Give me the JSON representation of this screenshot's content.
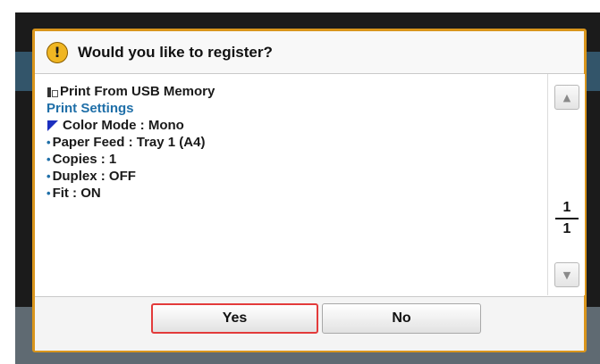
{
  "dialog": {
    "title": "Would you like to register?",
    "warning_glyph": "!",
    "icon": "warning-icon"
  },
  "content": {
    "heading": "Print From USB Memory",
    "section": "Print Settings",
    "selected_item": "Color Mode : Mono",
    "items": [
      "Paper Feed : Tray 1 (A4)",
      "Copies : 1",
      "Duplex : OFF",
      "Fit : ON"
    ]
  },
  "pager": {
    "current": "1",
    "total": "1"
  },
  "buttons": {
    "yes": "Yes",
    "no": "No"
  },
  "colors": {
    "border": "#d9951c",
    "accent": "#1f6fa8",
    "selection": "#e33b3b"
  }
}
